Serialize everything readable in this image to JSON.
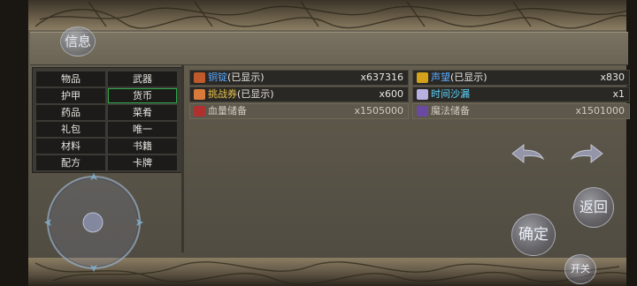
{
  "info_button": "信息",
  "categories": [
    {
      "label": "物品",
      "selected": false
    },
    {
      "label": "武器",
      "selected": false
    },
    {
      "label": "护甲",
      "selected": false
    },
    {
      "label": "货币",
      "selected": true
    },
    {
      "label": "药品",
      "selected": false
    },
    {
      "label": "菜肴",
      "selected": false
    },
    {
      "label": "礼包",
      "selected": false
    },
    {
      "label": "唯一",
      "selected": false
    },
    {
      "label": "材料",
      "selected": false
    },
    {
      "label": "书籍",
      "selected": false
    },
    {
      "label": "配方",
      "selected": false
    },
    {
      "label": "卡牌",
      "selected": false
    }
  ],
  "currencies": [
    {
      "name": "铜锭",
      "suffix": "(已显示)",
      "count": "x637316",
      "name_color": "#5aa8ff",
      "suffix_color": "#e8e6e0",
      "icon_color": "#c05a2a",
      "icon": "copper-ingot-icon"
    },
    {
      "name": "声望",
      "suffix": "(已显示)",
      "count": "x830",
      "name_color": "#5aa8ff",
      "suffix_color": "#e8e6e0",
      "icon_color": "#d4a21a",
      "icon": "reputation-icon"
    },
    {
      "name": "挑战券",
      "suffix": "(已显示)",
      "count": "x600",
      "name_color": "#e8c24a",
      "suffix_color": "#e8e6e0",
      "icon_color": "#d87a3a",
      "icon": "challenge-ticket-icon"
    },
    {
      "name": "时间沙漏",
      "suffix": "",
      "count": "x1",
      "name_color": "#5ad6ff",
      "suffix_color": "#e8e6e0",
      "icon_color": "#b8b0e0",
      "icon": "hourglass-icon"
    },
    {
      "name": "血量储备",
      "suffix": "",
      "count": "x1505000",
      "name_color": "#cfcabe",
      "suffix_color": "#cfcabe",
      "icon_color": "#b03030",
      "icon": "hp-reserve-icon"
    },
    {
      "name": "魔法储备",
      "suffix": "",
      "count": "x1501000",
      "name_color": "#cfcabe",
      "suffix_color": "#cfcabe",
      "icon_color": "#6a4aa0",
      "icon": "mp-reserve-icon"
    }
  ],
  "buttons": {
    "back": "返回",
    "confirm": "确定",
    "toggle": "开关"
  }
}
